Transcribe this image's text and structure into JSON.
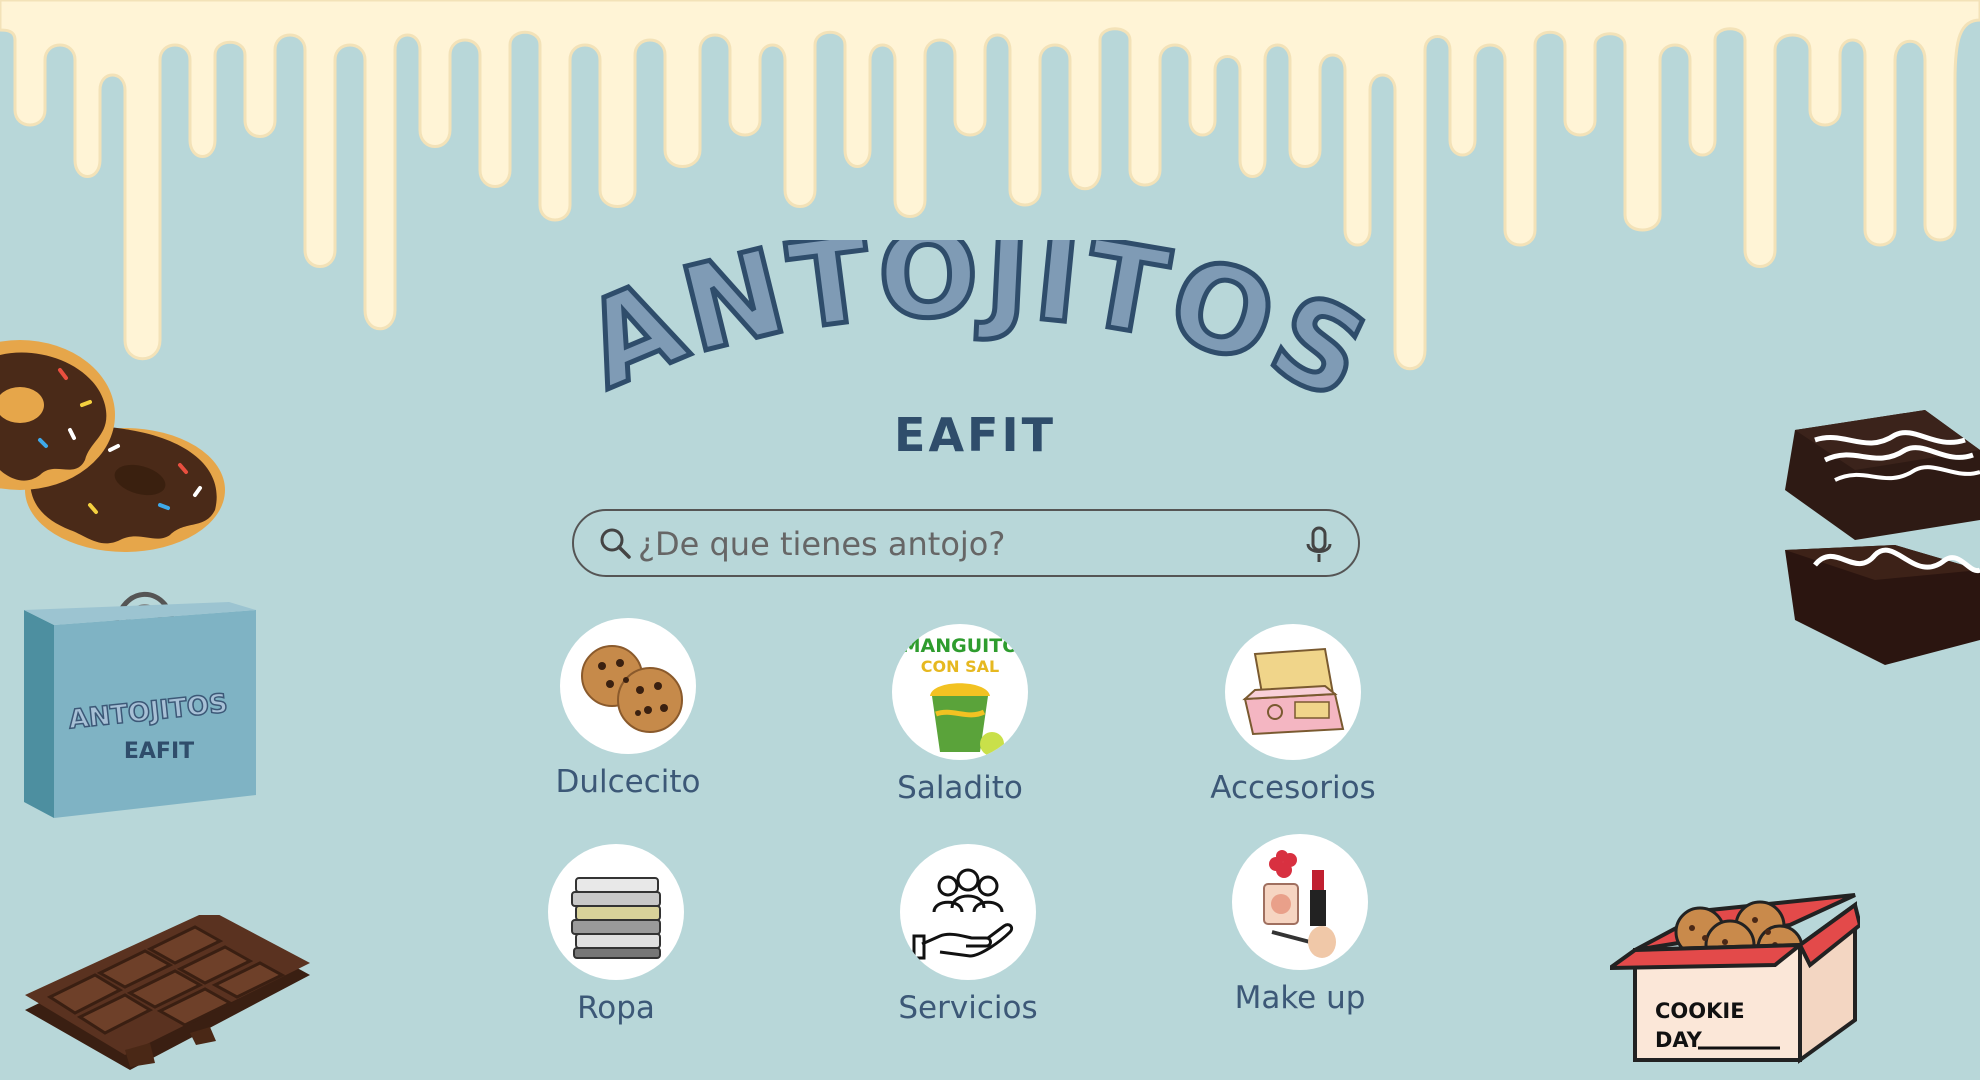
{
  "brand": {
    "title": "ANTOJITOS",
    "subtitle": "EAFIT"
  },
  "bag": {
    "title": "ANTOJITOS",
    "subtitle": "EAFIT"
  },
  "search": {
    "placeholder": "¿De que tienes antojo?",
    "search_icon": "search-icon",
    "mic_icon": "microphone-icon"
  },
  "categories": [
    {
      "label": "Dulcecito",
      "icon": "cookies-icon"
    },
    {
      "label": "Saladito",
      "icon": "mango-cup-icon"
    },
    {
      "label": "Accesorios",
      "icon": "jewelry-box-icon"
    },
    {
      "label": "Ropa",
      "icon": "folded-clothes-icon"
    },
    {
      "label": "Servicios",
      "icon": "hand-people-icon"
    },
    {
      "label": "Make up",
      "icon": "makeup-icon"
    }
  ],
  "mango_text": {
    "line1": "MANGUITO",
    "line2": "CON SAL"
  },
  "cookie_box": {
    "line1": "COOKIE",
    "line2": "DAY"
  },
  "colors": {
    "background": "#b8d7d9",
    "drip": "#fff4d6",
    "logo": "#7f9bb5",
    "logo_outline": "#2f4d6b",
    "label": "#3c5877"
  }
}
